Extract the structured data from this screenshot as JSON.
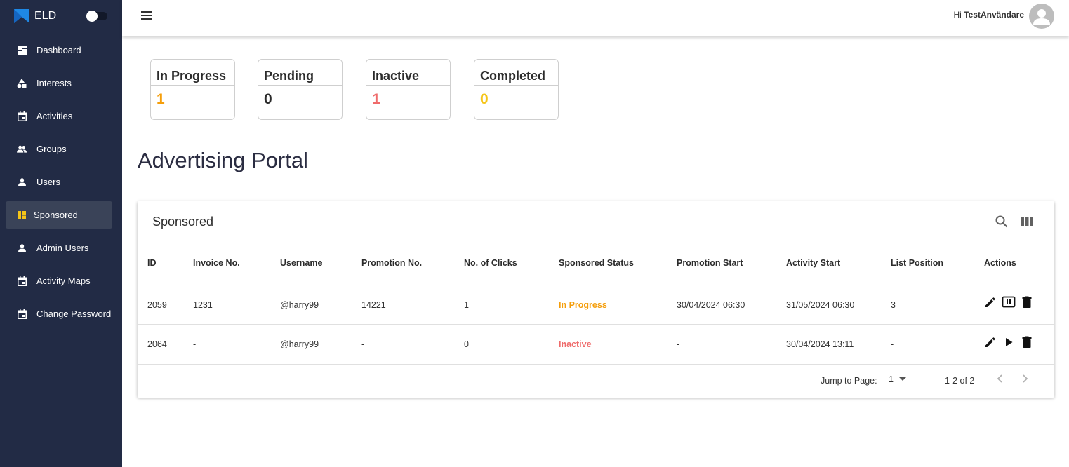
{
  "app": {
    "brand": "ELD"
  },
  "sidebar": {
    "items": [
      {
        "label": "Dashboard",
        "icon": "dashboard-icon"
      },
      {
        "label": "Interests",
        "icon": "shapes-icon"
      },
      {
        "label": "Activities",
        "icon": "calendar-icon"
      },
      {
        "label": "Groups",
        "icon": "group-icon"
      },
      {
        "label": "Users",
        "icon": "person-icon"
      },
      {
        "label": "Sponsored",
        "icon": "sponsored-icon",
        "active": true
      },
      {
        "label": "Admin Users",
        "icon": "person-icon"
      },
      {
        "label": "Activity Maps",
        "icon": "calendar-icon"
      },
      {
        "label": "Change Password",
        "icon": "calendar-icon"
      }
    ]
  },
  "header": {
    "greeting_prefix": "Hi",
    "username": "TestAnvändare"
  },
  "stats": [
    {
      "title": "In Progress",
      "value": "1",
      "color": "#f59e0b"
    },
    {
      "title": "Pending",
      "value": "0",
      "color": "#2b2b2b"
    },
    {
      "title": "Inactive",
      "value": "1",
      "color": "#ef6b6b"
    },
    {
      "title": "Completed",
      "value": "0",
      "color": "#f5c518"
    }
  ],
  "page": {
    "title": "Advertising Portal"
  },
  "table": {
    "title": "Sponsored",
    "columns": [
      "ID",
      "Invoice No.",
      "Username",
      "Promotion No.",
      "No. of Clicks",
      "Sponsored Status",
      "Promotion Start",
      "Activity Start",
      "List Position",
      "Actions"
    ],
    "rows": [
      {
        "id": "2059",
        "invoice": "1231",
        "username": "@harry99",
        "promotion": "14221",
        "clicks": "1",
        "status": "In Progress",
        "promotion_start": "30/04/2024 06:30",
        "activity_start": "31/05/2024 06:30",
        "position": "3",
        "toggle_action": "pause-icon"
      },
      {
        "id": "2064",
        "invoice": "-",
        "username": "@harry99",
        "promotion": "-",
        "clicks": "0",
        "status": "Inactive",
        "promotion_start": "-",
        "activity_start": "30/04/2024 13:11",
        "position": "-",
        "toggle_action": "play-icon"
      }
    ],
    "footer": {
      "jump_label": "Jump to Page:",
      "page": "1",
      "range": "1-2 of 2"
    }
  },
  "colors": {
    "sidebar": "#222b45",
    "active_item": "#3a4358",
    "accent_blue": "#1e88e5",
    "in_progress": "#f59e0b",
    "inactive": "#ef6b6b",
    "completed": "#f5c518"
  }
}
